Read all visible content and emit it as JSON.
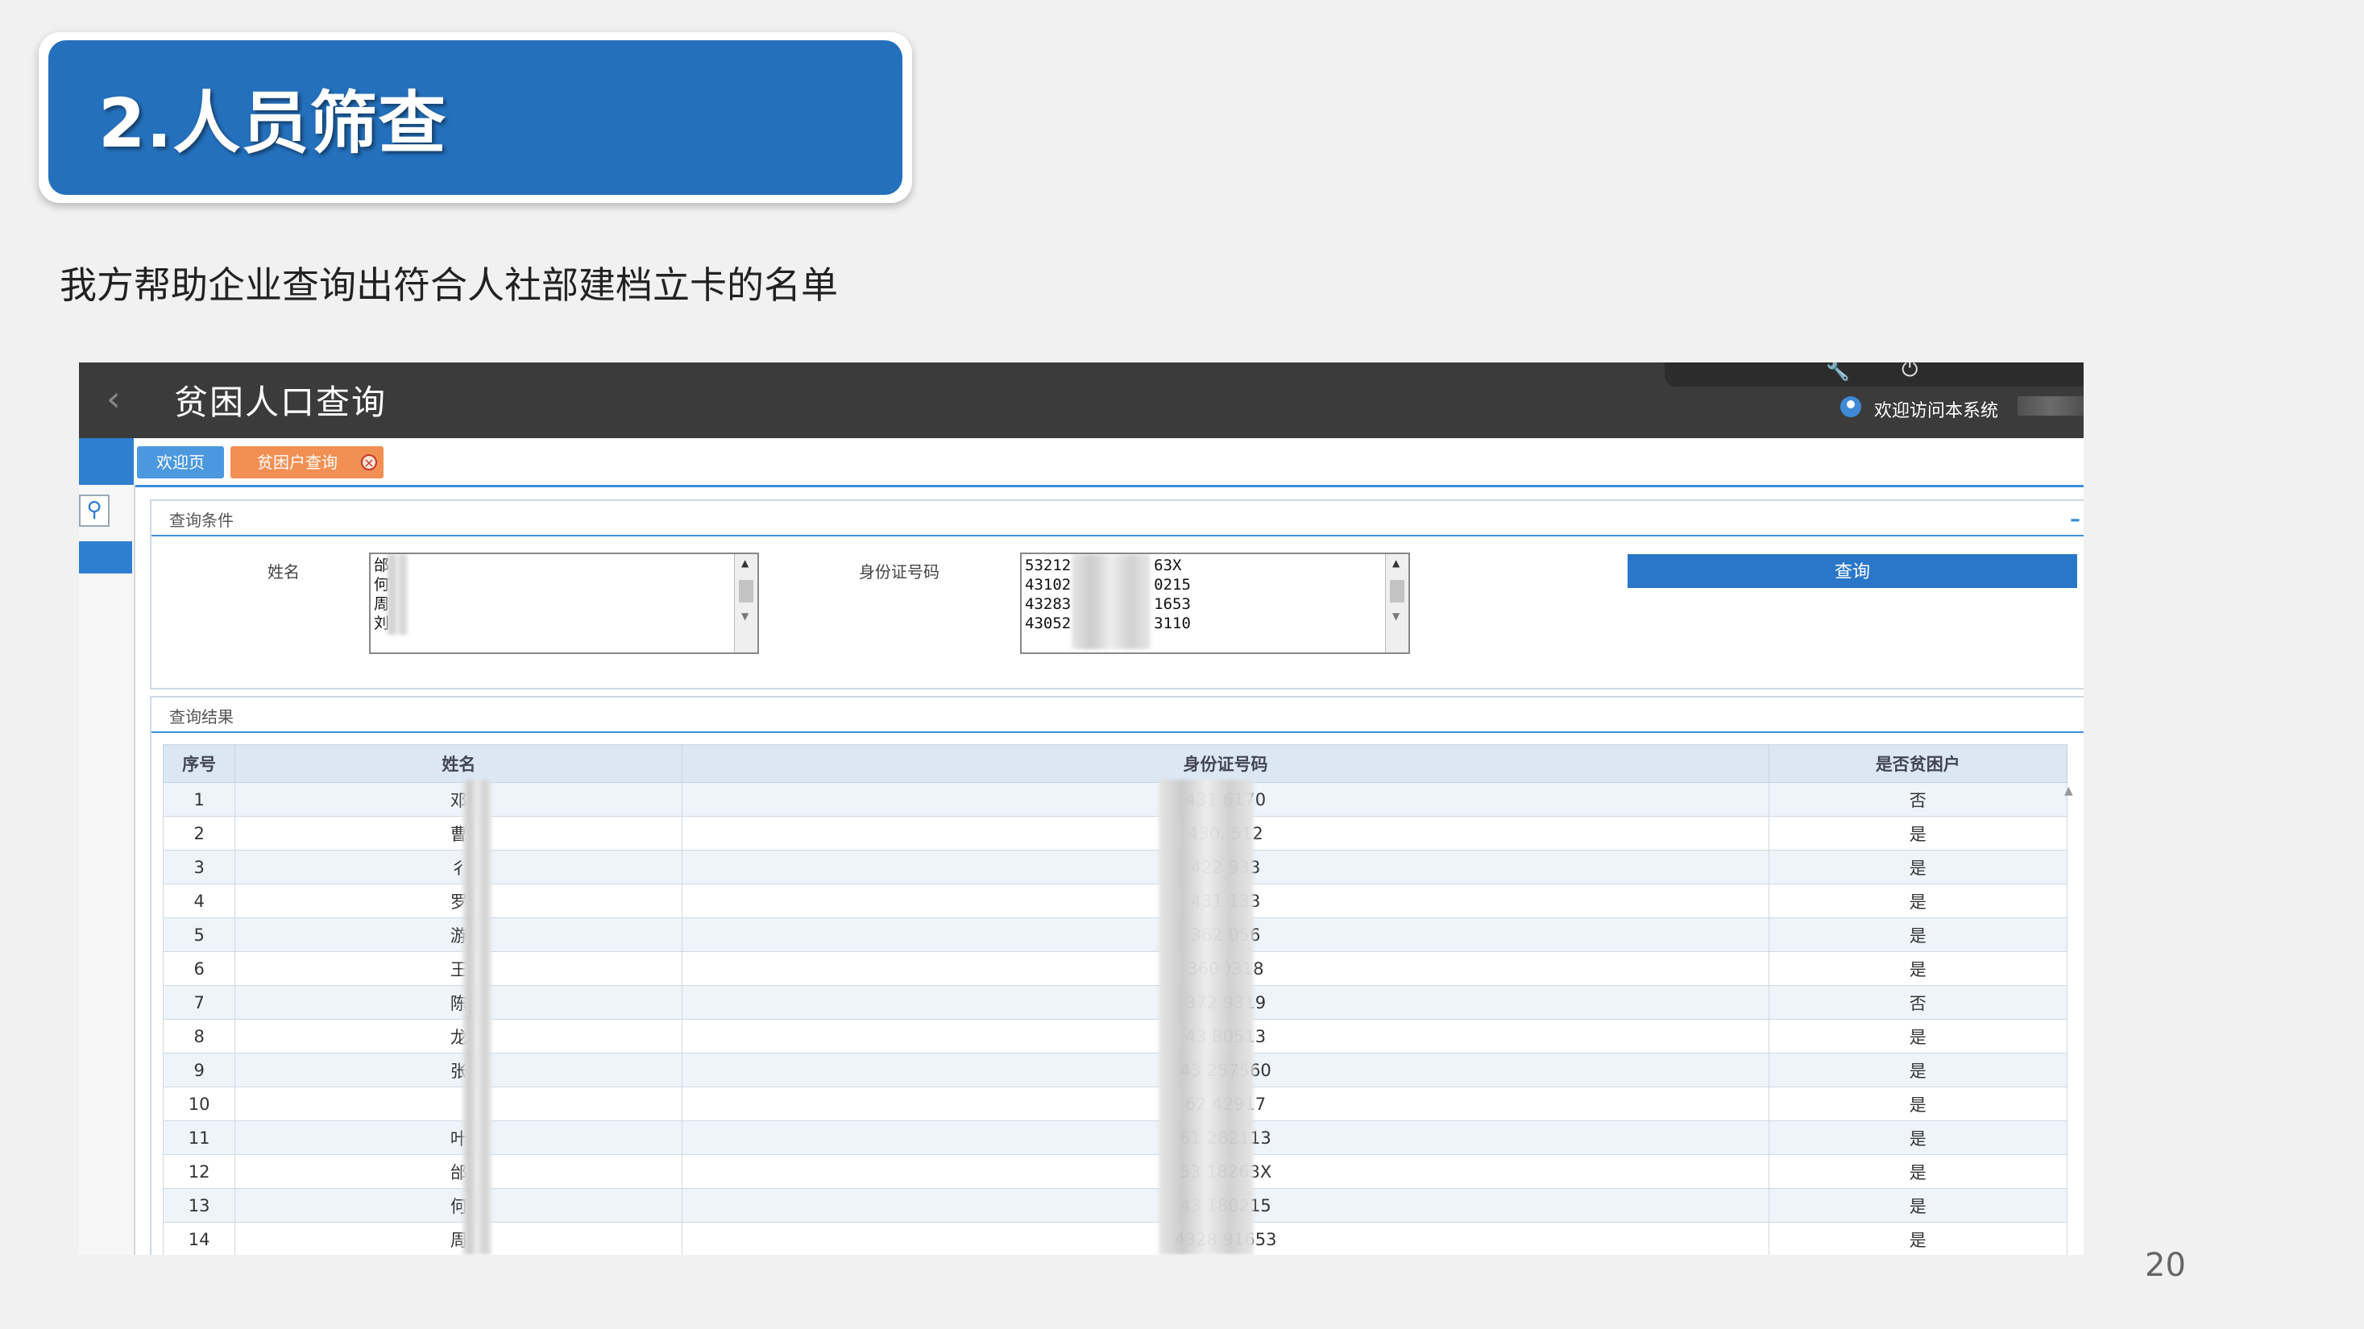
{
  "slide": {
    "title": "2.人员筛查",
    "subtitle": "我方帮助企业查询出符合人社部建档立卡的名单",
    "page_number": "20"
  },
  "app": {
    "title": "贫困人口查询",
    "welcome": "欢迎访问本系统",
    "tabs": [
      "欢迎页",
      "贫困户查询"
    ]
  },
  "conditions": {
    "section_title": "查询条件",
    "name_label": "姓名",
    "id_label": "身份证号码",
    "name_lines": "邰\n何\n周\n刘",
    "id_lines": "53212         63X\n43102         0215\n43283         1653\n43052         3110",
    "query_button": "查询"
  },
  "results": {
    "section_title": "查询结果",
    "columns": [
      "序号",
      "姓名",
      "身份证号码",
      "是否贫困户"
    ],
    "rows": [
      {
        "no": "1",
        "name": "邓",
        "id": "431          6170",
        "poor": "否"
      },
      {
        "no": "2",
        "name": "曹",
        "id": "430.          512",
        "poor": "是"
      },
      {
        "no": "3",
        "name": "彳",
        "id": "422           933",
        "poor": "是"
      },
      {
        "no": "4",
        "name": "罗",
        "id": "431           133",
        "poor": "是"
      },
      {
        "no": "5",
        "name": "游",
        "id": "362          056",
        "poor": "是"
      },
      {
        "no": "6",
        "name": "王",
        "id": "360          )318",
        "poor": "是"
      },
      {
        "no": "7",
        "name": "陈",
        "id": "372          9319",
        "poor": "否"
      },
      {
        "no": "8",
        "name": "龙",
        "id": "43          80513",
        "poor": "是"
      },
      {
        "no": "9",
        "name": "张",
        "id": "43          257560",
        "poor": "是"
      },
      {
        "no": "10",
        "name": "",
        "id": "62          42917",
        "poor": "是"
      },
      {
        "no": "11",
        "name": "叶",
        "id": "61          282113",
        "poor": "是"
      },
      {
        "no": "12",
        "name": "邰",
        "id": "53          18263X",
        "poor": "是"
      },
      {
        "no": "13",
        "name": "何",
        "id": "43          180215",
        "poor": "是"
      },
      {
        "no": "14",
        "name": "周",
        "id": "4328          91653",
        "poor": "是"
      }
    ]
  }
}
